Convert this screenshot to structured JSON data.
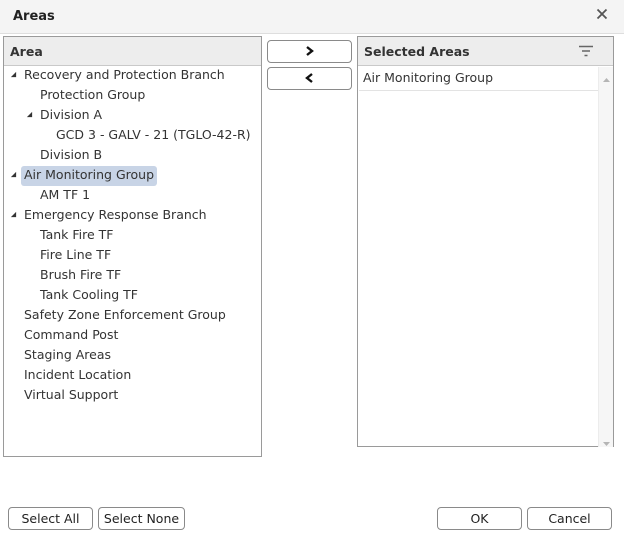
{
  "dialog": {
    "title": "Areas"
  },
  "left_panel": {
    "header": "Area",
    "tree": [
      {
        "label": "Recovery and Protection Branch",
        "expanded": true
      },
      {
        "label": "Protection Group"
      },
      {
        "label": "Division A",
        "expanded": true
      },
      {
        "label": "GCD 3 - GALV - 21 (TGLO-42-R)"
      },
      {
        "label": "Division B"
      },
      {
        "label": "Air Monitoring Group",
        "expanded": true,
        "selected": true
      },
      {
        "label": "AM TF 1"
      },
      {
        "label": "Emergency Response Branch",
        "expanded": true
      },
      {
        "label": "Tank Fire TF"
      },
      {
        "label": "Fire Line TF"
      },
      {
        "label": "Brush Fire TF"
      },
      {
        "label": "Tank Cooling TF"
      },
      {
        "label": "Safety Zone Enforcement Group"
      },
      {
        "label": "Command Post"
      },
      {
        "label": "Staging Areas"
      },
      {
        "label": "Incident Location"
      },
      {
        "label": "Virtual Support"
      }
    ]
  },
  "right_panel": {
    "header": "Selected Areas",
    "items": [
      "Air Monitoring Group"
    ]
  },
  "buttons": {
    "select_all": "Select All",
    "select_none": "Select None",
    "ok": "OK",
    "cancel": "Cancel"
  },
  "icons": {
    "close": "close-icon",
    "move_right": "chevron-right-icon",
    "move_left": "chevron-left-icon",
    "filter": "filter-icon",
    "expanded_node": "expanded-triangle-icon"
  }
}
